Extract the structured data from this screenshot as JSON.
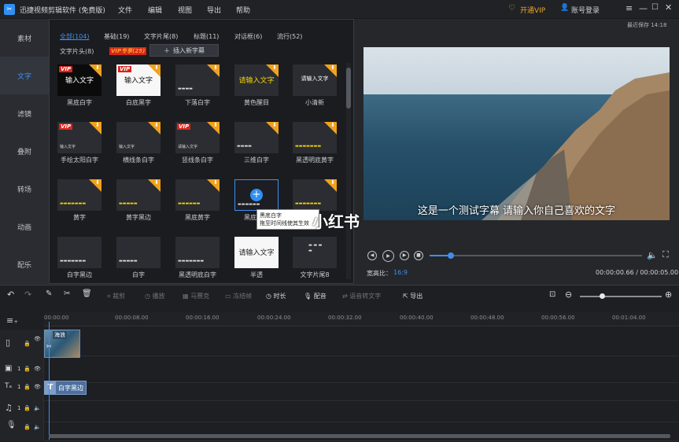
{
  "app": {
    "title": "迅捷视频剪辑软件 (免费版)"
  },
  "menu": [
    "文件",
    "编辑",
    "视图",
    "导出",
    "帮助"
  ],
  "header_right": {
    "vip": "开通VIP",
    "login": "账号登录",
    "last_saved": "最近保存 14:18"
  },
  "sidebar": [
    "素材",
    "文字",
    "滤镜",
    "叠附",
    "转场",
    "动画",
    "配乐"
  ],
  "tabs_row1": [
    "全部(104)",
    "基础(19)",
    "文字片尾(8)",
    "标题(11)",
    "对话框(6)",
    "流行(52)"
  ],
  "tabs_row2": [
    "文字片头(8)",
    "VIP专享(25)"
  ],
  "insert_button": "插入新字幕",
  "cards": [
    {
      "label": "黑底白字",
      "preview": "输入文字"
    },
    {
      "label": "白底黑字",
      "preview": "输入文字"
    },
    {
      "label": "下落白字",
      "preview": ""
    },
    {
      "label": "黄色醒目",
      "preview": "请输入文字"
    },
    {
      "label": "小清新",
      "preview": "请输入文字"
    },
    {
      "label": "手绘太阳白字",
      "preview": "输入文字"
    },
    {
      "label": "横线条白字",
      "preview": "输入文字"
    },
    {
      "label": "竖线条白字",
      "preview": "请输入文字"
    },
    {
      "label": "三维白字",
      "preview": ""
    },
    {
      "label": "黑透明底黄字",
      "preview": ""
    },
    {
      "label": "黄字",
      "preview": ""
    },
    {
      "label": "黄字黑边",
      "preview": ""
    },
    {
      "label": "黑底黄字",
      "preview": ""
    },
    {
      "label": "黑底白字",
      "preview": ""
    },
    {
      "label": "",
      "preview": ""
    },
    {
      "label": "白字黑边",
      "preview": ""
    },
    {
      "label": "白字",
      "preview": ""
    },
    {
      "label": "黑透明底白字",
      "preview": ""
    },
    {
      "label": "半透",
      "preview": "请输入文字"
    },
    {
      "label": "文字片尾8",
      "preview": ""
    }
  ],
  "tooltip": {
    "line1": "黑底白字",
    "line2": "拖至时间线使其生效"
  },
  "preview": {
    "subtitle": "这是一个测试字幕 请输入你自己喜欢的文字",
    "watermark": "小红书",
    "ratio_label": "宽高比：",
    "ratio": "16:9",
    "time": "00:00:00.66 / 00:00:05.00",
    "progress": 0.1
  },
  "toolbar": [
    "裁剪",
    "播放",
    "马赛克",
    "冻结帧",
    "时长",
    "配音",
    "语音转文字",
    "导出"
  ],
  "ruler": [
    "00:00:00",
    "00:00:08.00",
    "00:00:16.00",
    "00:00:24.00",
    "00:00:32.00",
    "00:00:40.00",
    "00:00:48.00",
    "00:00:56.00",
    "00:01:04.00"
  ],
  "clips": {
    "video": "海浪",
    "text": "白字黑边"
  },
  "track_numbers": [
    "1",
    "1",
    "1"
  ],
  "colors": {
    "accent": "#3e8ff0",
    "vip": "#f3a527",
    "download": "#f0a21e"
  }
}
